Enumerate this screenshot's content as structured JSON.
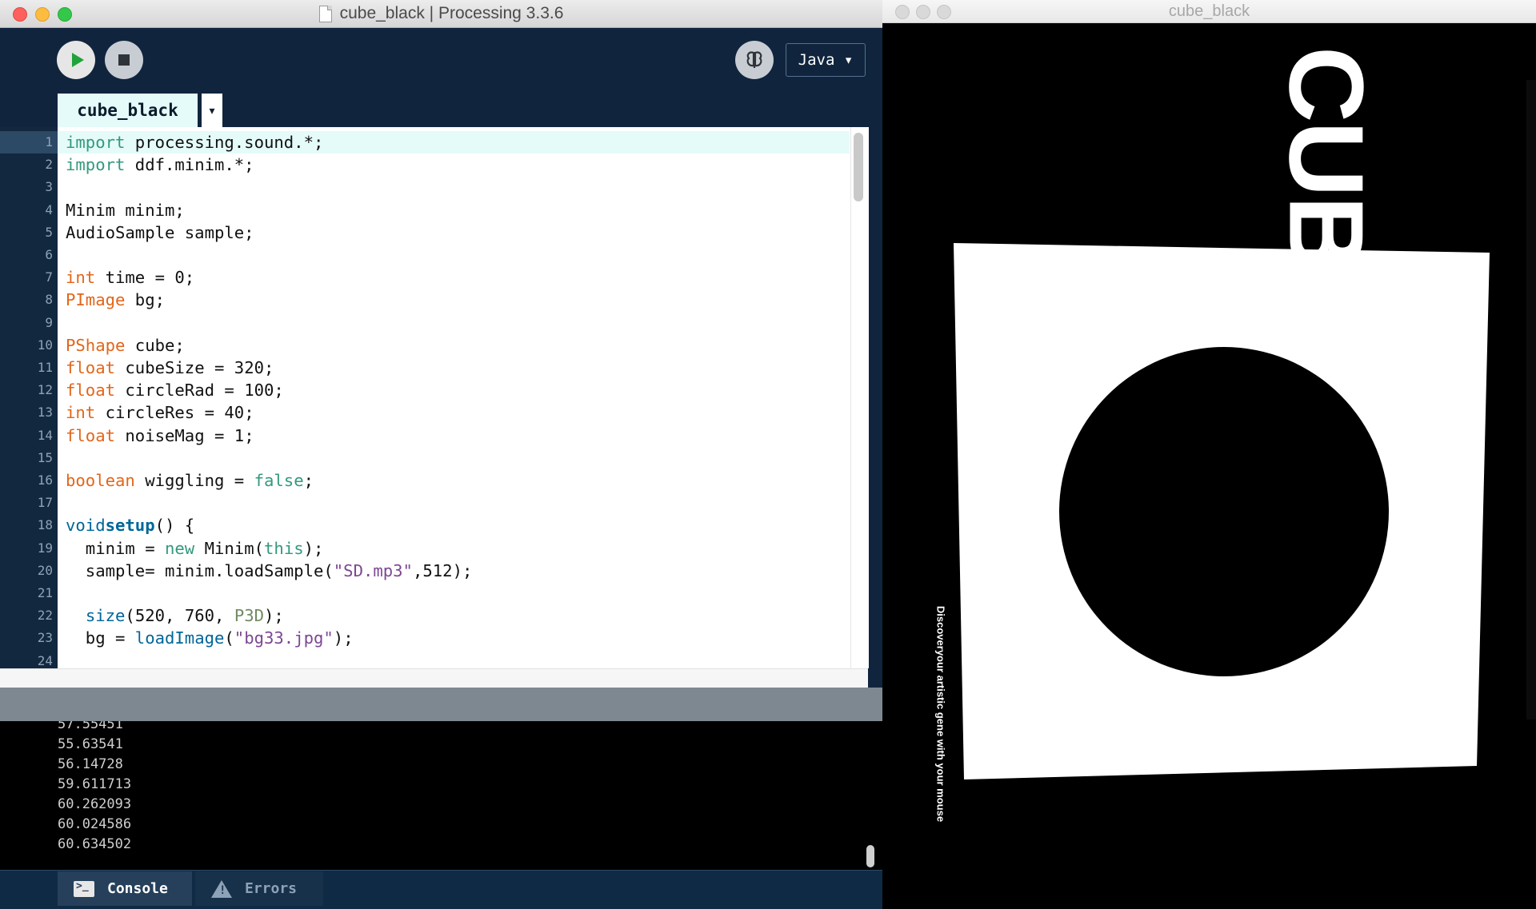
{
  "ide": {
    "window_title": "cube_black | Processing 3.3.6",
    "mode": "Java ▾",
    "tab_label": "cube_black",
    "tab_menu_glyph": "▾"
  },
  "code": {
    "lines": [
      [
        [
          "kw-t",
          "import"
        ],
        [
          "",
          "processing.sound.*;"
        ]
      ],
      [
        [
          "kw-t",
          "import"
        ],
        [
          "",
          "ddf.minim.*;"
        ]
      ],
      [],
      [
        [
          "",
          "Minim minim;"
        ]
      ],
      [
        [
          "",
          "AudioSample sample;"
        ]
      ],
      [],
      [
        [
          "kw-o",
          "int"
        ],
        [
          "",
          "time = 0;"
        ]
      ],
      [
        [
          "kw-o",
          "PImage"
        ],
        [
          "",
          "bg;"
        ]
      ],
      [],
      [
        [
          "kw-o",
          "PShape"
        ],
        [
          "",
          "cube;"
        ]
      ],
      [
        [
          "kw-o",
          "float"
        ],
        [
          "",
          "cubeSize = 320;"
        ]
      ],
      [
        [
          "kw-o",
          "float"
        ],
        [
          "",
          "circleRad = 100;"
        ]
      ],
      [
        [
          "kw-o",
          "int"
        ],
        [
          "",
          "circleRes = 40;"
        ]
      ],
      [
        [
          "kw-o",
          "float"
        ],
        [
          "",
          "noiseMag = 1;"
        ]
      ],
      [],
      [
        [
          "kw-o",
          "boolean"
        ],
        [
          "",
          "wiggling = "
        ],
        [
          "kw-t",
          "false"
        ],
        [
          "",
          ";"
        ]
      ],
      [],
      [
        [
          "kw-b",
          "void"
        ],
        [
          "",
          ""
        ],
        [
          "kw-bb",
          "setup"
        ],
        [
          "",
          "() {"
        ]
      ],
      [
        [
          "",
          "  minim = "
        ],
        [
          "kw-t",
          "new"
        ],
        [
          "",
          "Minim("
        ],
        [
          "kw-t",
          "this"
        ],
        [
          "",
          ");"
        ]
      ],
      [
        [
          "",
          "  sample= minim.loadSample("
        ],
        [
          "str",
          "\"SD.mp3\""
        ],
        [
          "",
          ",512);"
        ]
      ],
      [],
      [
        [
          "",
          "  "
        ],
        [
          "kw-b",
          "size"
        ],
        [
          "",
          "(520, 760, "
        ],
        [
          "k3d",
          "P3D"
        ],
        [
          "",
          ");"
        ]
      ],
      [
        [
          "",
          "  bg = "
        ],
        [
          "kw-b",
          "loadImage"
        ],
        [
          "",
          "("
        ],
        [
          "str",
          "\"bg33.jpg\""
        ],
        [
          "",
          ");"
        ]
      ],
      []
    ]
  },
  "console": {
    "partial_line": "57.55451",
    "lines": [
      "55.63541",
      "56.14728",
      "59.611713",
      "60.262093",
      "60.024586",
      "60.634502"
    ]
  },
  "bottom_tabs": {
    "console": "Console",
    "errors": "Errors"
  },
  "sketch": {
    "window_title": "cube_black",
    "cube_text": "CUB",
    "tagline": "Discoveryour artistic gene with your mouse"
  },
  "icons": {
    "run": "play-icon",
    "stop": "stop-icon",
    "debug": "butterfly-debug-icon",
    "console_tab": "terminal-icon",
    "errors_tab": "warning-icon"
  },
  "colors": {
    "ide_background": "#10253d",
    "keyword_orange": "#e2661a",
    "keyword_teal": "#33997e",
    "function_blue": "#006699",
    "string_purple": "#7d4793",
    "run_green": "#1fa33a"
  }
}
